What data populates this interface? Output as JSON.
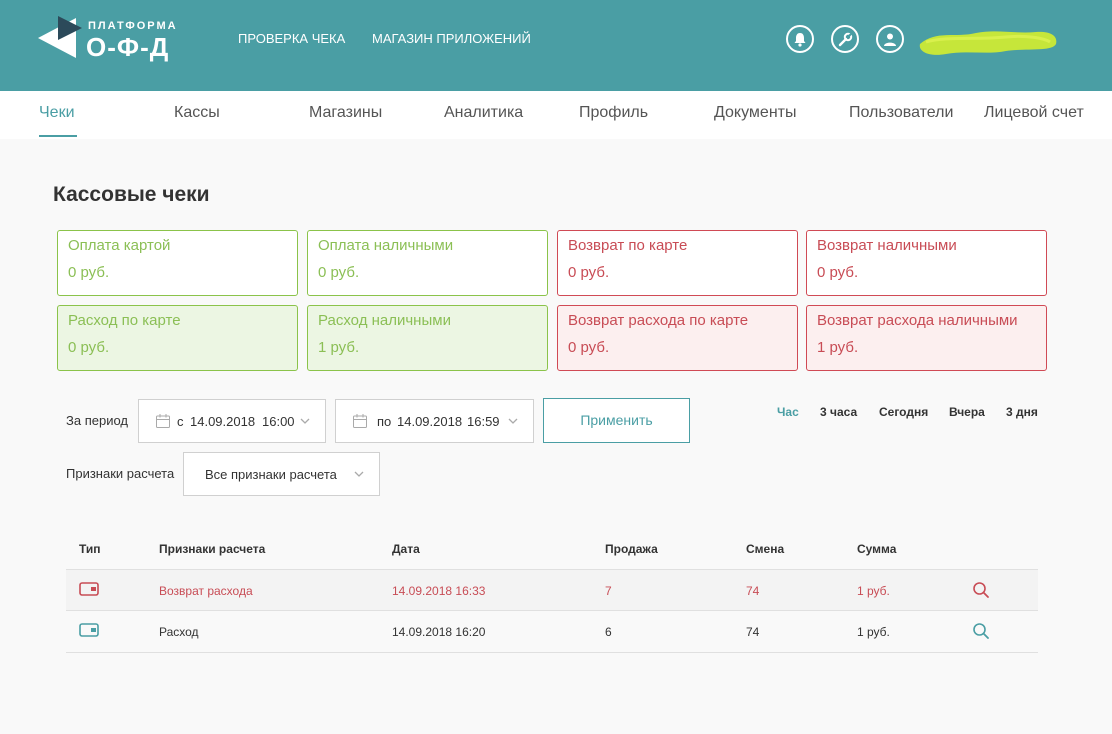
{
  "header": {
    "logo": {
      "top": "ПЛАТФОРМА",
      "main": "О-Ф-Д"
    },
    "links": [
      "ПРОВЕРКА ЧЕКА",
      "МАГАЗИН ПРИЛОЖЕНИЙ"
    ],
    "icons": [
      "bell-icon",
      "wrench-icon",
      "user-icon"
    ],
    "background": "#4a9ea4"
  },
  "tabs": [
    {
      "label": "Чеки",
      "active": true
    },
    {
      "label": "Кассы"
    },
    {
      "label": "Магазины"
    },
    {
      "label": "Аналитика"
    },
    {
      "label": "Профиль"
    },
    {
      "label": "Документы"
    },
    {
      "label": "Пользователи"
    },
    {
      "label": "Лицевой счет"
    }
  ],
  "page_title": "Кассовые чеки",
  "cards": [
    {
      "label": "Оплата картой",
      "value": "0 руб.",
      "tone": "green"
    },
    {
      "label": "Оплата наличными",
      "value": "0 руб.",
      "tone": "green"
    },
    {
      "label": "Возврат по карте",
      "value": "0 руб.",
      "tone": "red"
    },
    {
      "label": "Возврат наличными",
      "value": "0 руб.",
      "tone": "red"
    },
    {
      "label": "Расход по карте",
      "value": "0 руб.",
      "tone": "green"
    },
    {
      "label": "Расход наличными",
      "value": "1 руб.",
      "tone": "green"
    },
    {
      "label": "Возврат расхода по карте",
      "value": "0 руб.",
      "tone": "red"
    },
    {
      "label": "Возврат расхода наличными",
      "value": "1 руб.",
      "tone": "red"
    }
  ],
  "filters": {
    "period_label": "За период",
    "from": {
      "prefix": "с",
      "date": "14.09.2018",
      "time": "16:00"
    },
    "to": {
      "prefix": "по",
      "date": "14.09.2018",
      "time": "16:59"
    },
    "apply": "Применить",
    "quick": [
      {
        "label": "Час",
        "active": true
      },
      {
        "label": "3 часа"
      },
      {
        "label": "Сегодня"
      },
      {
        "label": "Вчера"
      },
      {
        "label": "3 дня"
      }
    ],
    "sign_label": "Признаки расчета",
    "sign_value": "Все признаки расчета"
  },
  "table": {
    "headers": [
      "Тип",
      "Признаки расчета",
      "Дата",
      "Продажа",
      "Смена",
      "Сумма"
    ],
    "rows": [
      {
        "sign": "Возврат расхода",
        "date": "14.09.2018 16:33",
        "sale": "7",
        "shift": "74",
        "sum": "1 руб.",
        "status_color": "#c84c55"
      },
      {
        "sign": "Расход",
        "date": "14.09.2018 16:20",
        "sale": "6",
        "shift": "74",
        "sum": "1 руб.",
        "status_color": "#4a9ea4"
      }
    ]
  }
}
